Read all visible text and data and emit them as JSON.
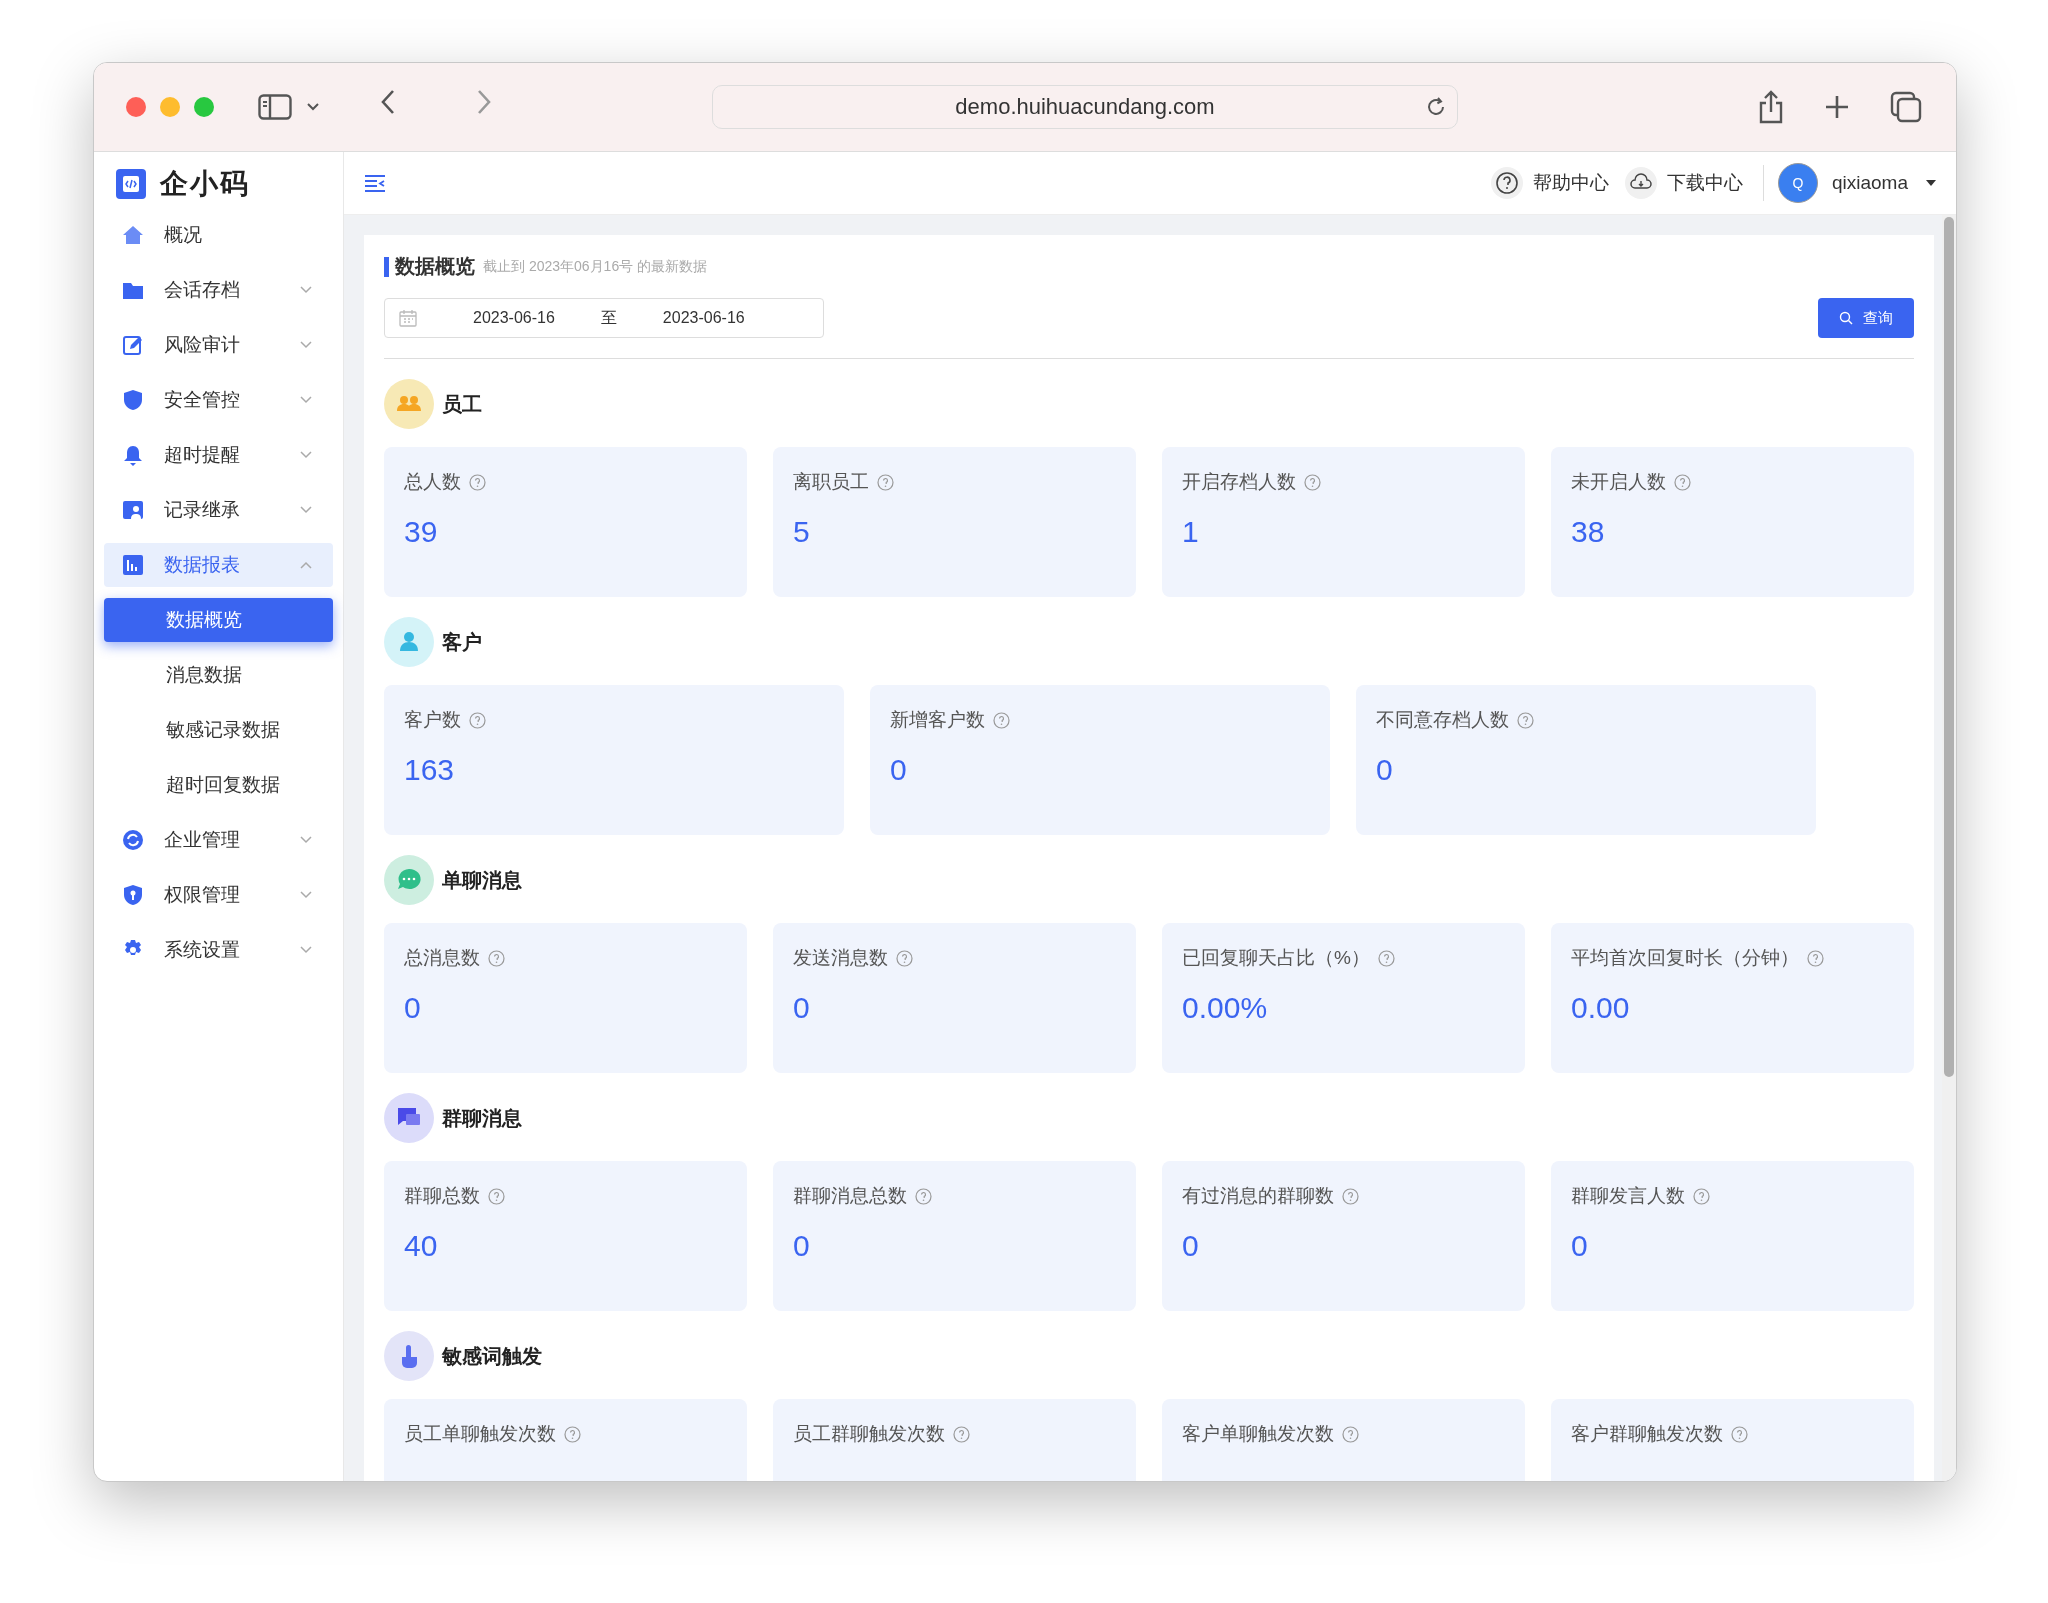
{
  "browser": {
    "url": "demo.huihuacundang.com"
  },
  "sidebar": {
    "logo": "企小码",
    "items": [
      {
        "label": "概况",
        "kind": "home",
        "selected": false
      },
      {
        "label": "会话存档",
        "kind": "folder",
        "expanded": false,
        "selected": false
      },
      {
        "label": "风险审计",
        "kind": "edit",
        "expanded": false,
        "selected": false
      },
      {
        "label": "安全管控",
        "kind": "shield",
        "expanded": false,
        "selected": false
      },
      {
        "label": "超时提醒",
        "kind": "bell",
        "expanded": false,
        "selected": false
      },
      {
        "label": "记录继承",
        "kind": "person",
        "expanded": false,
        "selected": false
      },
      {
        "label": "数据报表",
        "kind": "chart",
        "expanded": true,
        "selected": true,
        "children": [
          {
            "label": "数据概览",
            "selected": true
          },
          {
            "label": "消息数据",
            "selected": false
          },
          {
            "label": "敏感记录数据",
            "selected": false
          },
          {
            "label": "超时回复数据",
            "selected": false
          }
        ]
      },
      {
        "label": "企业管理",
        "kind": "sync",
        "expanded": false,
        "selected": false
      },
      {
        "label": "权限管理",
        "kind": "key",
        "expanded": false,
        "selected": false
      },
      {
        "label": "系统设置",
        "kind": "gear",
        "expanded": false,
        "selected": false
      }
    ]
  },
  "header": {
    "help": "帮助中心",
    "download": "下载中心",
    "avatar": "Q",
    "user": "qixiaoma"
  },
  "overview": {
    "title": "数据概览",
    "subtitle": "截止到 2023年06月16号 的最新数据",
    "date_start": "2023-06-16",
    "date_separator": "至",
    "date_end": "2023-06-16",
    "query_button": "查询"
  },
  "sections": [
    {
      "title": "员工",
      "kind": "people",
      "color": "#f7e9b5",
      "cards": [
        {
          "label": "总人数",
          "value": "39"
        },
        {
          "label": "离职员工",
          "value": "5"
        },
        {
          "label": "开启存档人数",
          "value": "1"
        },
        {
          "label": "未开启人数",
          "value": "38"
        }
      ]
    },
    {
      "title": "客户",
      "kind": "person",
      "color": "#d4f3f8",
      "cards": [
        {
          "label": "客户数",
          "value": "163"
        },
        {
          "label": "新增客户数",
          "value": "0"
        },
        {
          "label": "不同意存档人数",
          "value": "0"
        }
      ]
    },
    {
      "title": "单聊消息",
      "kind": "chat",
      "color": "#cdeee0",
      "cards": [
        {
          "label": "总消息数",
          "value": "0"
        },
        {
          "label": "发送消息数",
          "value": "0"
        },
        {
          "label": "已回复聊天占比（%）",
          "value": "0.00%"
        },
        {
          "label": "平均首次回复时长（分钟）",
          "value": "0.00"
        }
      ]
    },
    {
      "title": "群聊消息",
      "kind": "group",
      "color": "#dcdcfa",
      "cards": [
        {
          "label": "群聊总数",
          "value": "40"
        },
        {
          "label": "群聊消息总数",
          "value": "0"
        },
        {
          "label": "有过消息的群聊数",
          "value": "0"
        },
        {
          "label": "群聊发言人数",
          "value": "0"
        }
      ]
    },
    {
      "title": "敏感词触发",
      "kind": "touch",
      "color": "#e3e4f8",
      "cards": [
        {
          "label": "员工单聊触发次数"
        },
        {
          "label": "员工群聊触发次数"
        },
        {
          "label": "客户单聊触发次数"
        },
        {
          "label": "客户群聊触发次数"
        }
      ]
    }
  ]
}
